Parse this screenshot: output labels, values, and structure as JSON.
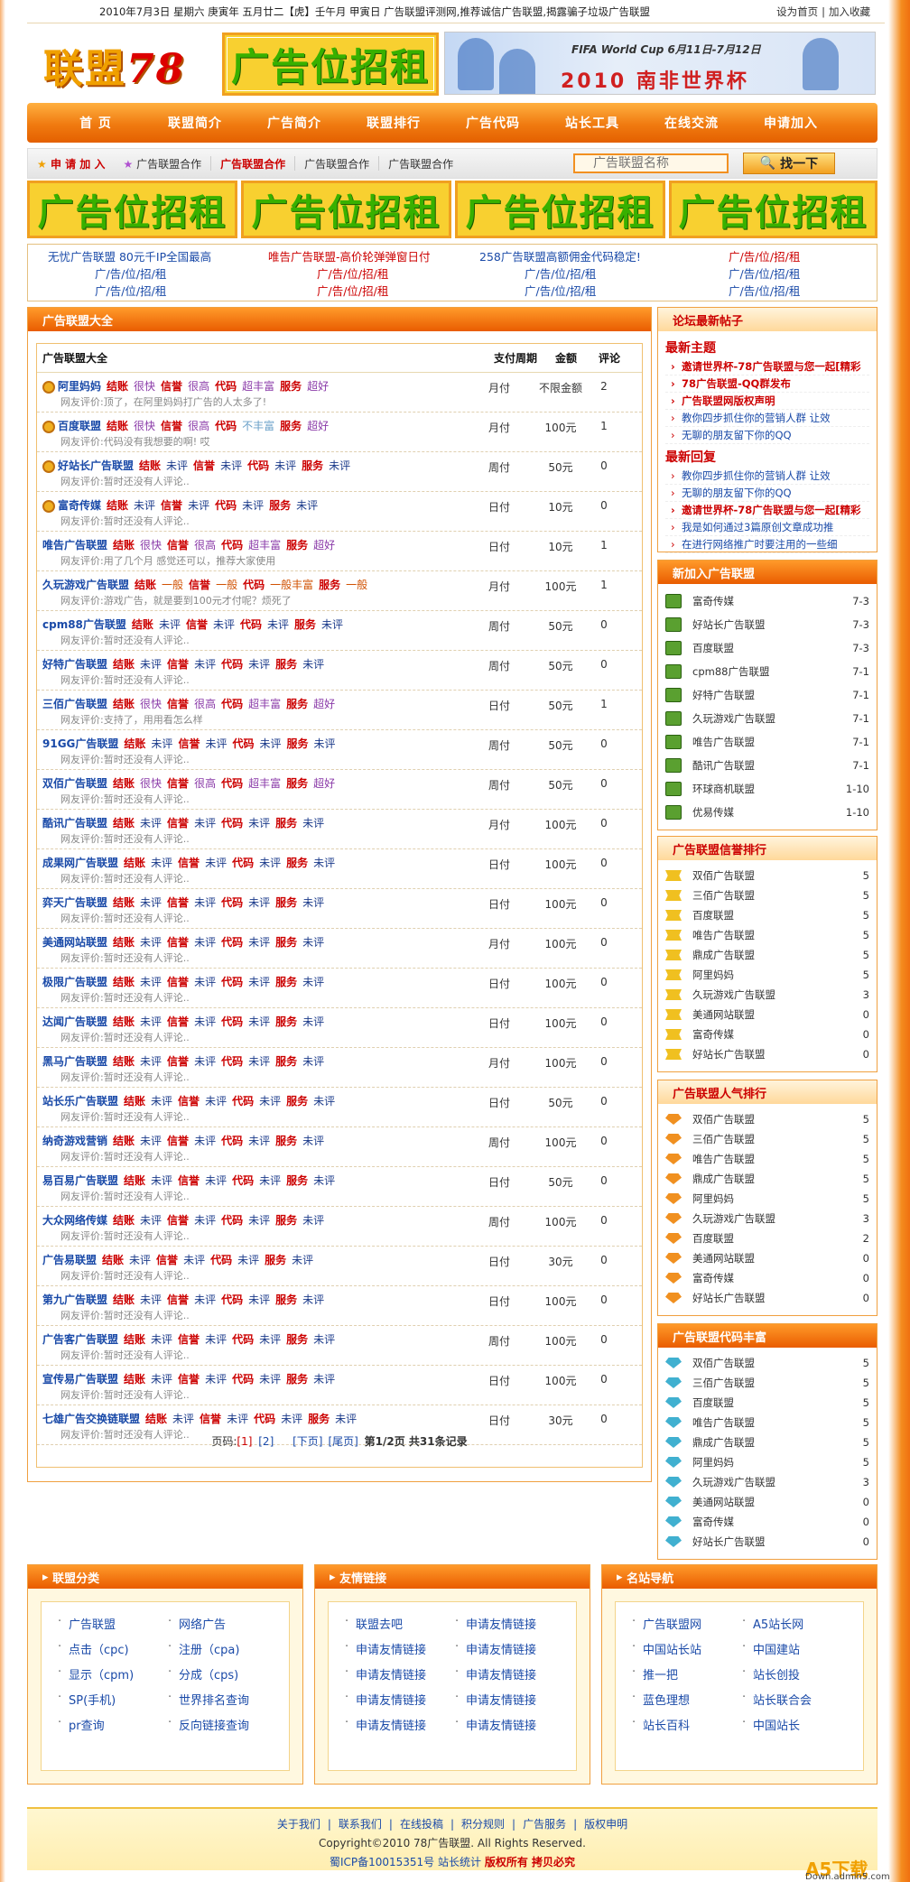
{
  "topbar": {
    "left": "2010年7月3日 星期六  庚寅年 五月廿二【虎】壬午月 甲寅日    广告联盟评测网,推荐诚信广告联盟,揭露骗子垃圾广告联盟",
    "set_home": "设为首页",
    "add_fav": "加入收藏"
  },
  "logo": {
    "cn": "联盟",
    "num": "78"
  },
  "header_ad": "广告位招租",
  "banner": {
    "line1": "FIFA World Cup 6月11日-7月12日",
    "line2": "2010 南非世界杯"
  },
  "nav": [
    "首 页",
    "联盟简介",
    "广告简介",
    "联盟排行",
    "广告代码",
    "站长工具",
    "在线交流",
    "申请加入"
  ],
  "subnav": {
    "join": "申 请 加 入",
    "items": [
      "广告联盟合作",
      "广告联盟合作",
      "广告联盟合作",
      "广告联盟合作"
    ],
    "search_placeholder": "广告联盟名称",
    "search_btn": "找一下"
  },
  "ad_row": [
    "广告位招租",
    "广告位招租",
    "广告位招租",
    "广告位招租"
  ],
  "links": {
    "row1": [
      "无忧广告联盟 80元千IP全国最高",
      "唯告广告联盟-高价轮弹弹窗日付",
      "258广告联盟高额佣金代码稳定!",
      "广/告/位/招/租"
    ],
    "rest": "广/告/位/招/租"
  },
  "main": {
    "title": "广告联盟大全",
    "cols": {
      "name": "广告联盟大全",
      "period": "支付周期",
      "amount": "金额",
      "comments": "评论"
    },
    "labels": {
      "settle": "结账",
      "credit": "信誉",
      "code": "代码",
      "service": "服务",
      "comment": "网友评价:"
    },
    "rows": [
      {
        "name": "阿里妈妈",
        "medal": true,
        "settle": "很快",
        "credit": "很高",
        "code": "超丰富",
        "service": "超好",
        "c": "顶了，在阿里妈妈打广告的人太多了!",
        "per": "月付",
        "amt": "不限金额",
        "cnt": "2"
      },
      {
        "name": "百度联盟",
        "medal": true,
        "settle": "很快",
        "credit": "很高",
        "code": "不丰富",
        "service": "超好",
        "c": "代码没有我想要的啊! 哎",
        "per": "月付",
        "amt": "100元",
        "cnt": "1"
      },
      {
        "name": "好站长广告联盟",
        "medal": true,
        "settle": "未评",
        "credit": "未评",
        "code": "未评",
        "service": "未评",
        "c": "暂时还没有人评论..",
        "per": "周付",
        "amt": "50元",
        "cnt": "0"
      },
      {
        "name": "富奇传媒",
        "medal": true,
        "settle": "未评",
        "credit": "未评",
        "code": "未评",
        "service": "未评",
        "c": "暂时还没有人评论..",
        "per": "日付",
        "amt": "10元",
        "cnt": "0"
      },
      {
        "name": "唯告广告联盟",
        "medal": false,
        "settle": "很快",
        "credit": "很高",
        "code": "超丰富",
        "service": "超好",
        "c": "用了几个月 感觉还可以，推荐大家使用",
        "per": "日付",
        "amt": "10元",
        "cnt": "1"
      },
      {
        "name": "久玩游戏广告联盟",
        "medal": false,
        "settle": "一般",
        "credit": "一般",
        "code": "一般丰富",
        "service": "一般",
        "c": "游戏广告，就是要到100元才付呢？烦死了",
        "per": "月付",
        "amt": "100元",
        "cnt": "1"
      },
      {
        "name": "cpm88广告联盟",
        "medal": false,
        "settle": "未评",
        "credit": "未评",
        "code": "未评",
        "service": "未评",
        "c": "暂时还没有人评论..",
        "per": "周付",
        "amt": "50元",
        "cnt": "0"
      },
      {
        "name": "好特广告联盟",
        "medal": false,
        "settle": "未评",
        "credit": "未评",
        "code": "未评",
        "service": "未评",
        "c": "暂时还没有人评论..",
        "per": "周付",
        "amt": "50元",
        "cnt": "0"
      },
      {
        "name": "三佰广告联盟",
        "medal": false,
        "settle": "很快",
        "credit": "很高",
        "code": "超丰富",
        "service": "超好",
        "c": "支持了，用用看怎么样",
        "per": "日付",
        "amt": "50元",
        "cnt": "1"
      },
      {
        "name": "91GG广告联盟",
        "medal": false,
        "settle": "未评",
        "credit": "未评",
        "code": "未评",
        "service": "未评",
        "c": "暂时还没有人评论..",
        "per": "周付",
        "amt": "50元",
        "cnt": "0"
      },
      {
        "name": "双佰广告联盟",
        "medal": false,
        "settle": "很快",
        "credit": "很高",
        "code": "超丰富",
        "service": "超好",
        "c": "暂时还没有人评论..",
        "per": "周付",
        "amt": "50元",
        "cnt": "0"
      },
      {
        "name": "酷讯广告联盟",
        "medal": false,
        "settle": "未评",
        "credit": "未评",
        "code": "未评",
        "service": "未评",
        "c": "暂时还没有人评论..",
        "per": "月付",
        "amt": "100元",
        "cnt": "0"
      },
      {
        "name": "成果网广告联盟",
        "medal": false,
        "settle": "未评",
        "credit": "未评",
        "code": "未评",
        "service": "未评",
        "c": "暂时还没有人评论..",
        "per": "日付",
        "amt": "100元",
        "cnt": "0"
      },
      {
        "name": "弈天广告联盟",
        "medal": false,
        "settle": "未评",
        "credit": "未评",
        "code": "未评",
        "service": "未评",
        "c": "暂时还没有人评论..",
        "per": "日付",
        "amt": "100元",
        "cnt": "0"
      },
      {
        "name": "美通网站联盟",
        "medal": false,
        "settle": "未评",
        "credit": "未评",
        "code": "未评",
        "service": "未评",
        "c": "暂时还没有人评论..",
        "per": "月付",
        "amt": "100元",
        "cnt": "0"
      },
      {
        "name": "极限广告联盟",
        "medal": false,
        "settle": "未评",
        "credit": "未评",
        "code": "未评",
        "service": "未评",
        "c": "暂时还没有人评论..",
        "per": "日付",
        "amt": "100元",
        "cnt": "0"
      },
      {
        "name": "达闻广告联盟",
        "medal": false,
        "settle": "未评",
        "credit": "未评",
        "code": "未评",
        "service": "未评",
        "c": "暂时还没有人评论..",
        "per": "日付",
        "amt": "100元",
        "cnt": "0"
      },
      {
        "name": "黑马广告联盟",
        "medal": false,
        "settle": "未评",
        "credit": "未评",
        "code": "未评",
        "service": "未评",
        "c": "暂时还没有人评论..",
        "per": "月付",
        "amt": "100元",
        "cnt": "0"
      },
      {
        "name": "站长乐广告联盟",
        "medal": false,
        "settle": "未评",
        "credit": "未评",
        "code": "未评",
        "service": "未评",
        "c": "暂时还没有人评论..",
        "per": "日付",
        "amt": "50元",
        "cnt": "0"
      },
      {
        "name": "纳奇游戏营销",
        "medal": false,
        "settle": "未评",
        "credit": "未评",
        "code": "未评",
        "service": "未评",
        "c": "暂时还没有人评论..",
        "per": "周付",
        "amt": "100元",
        "cnt": "0"
      },
      {
        "name": "易百易广告联盟",
        "medal": false,
        "settle": "未评",
        "credit": "未评",
        "code": "未评",
        "service": "未评",
        "c": "暂时还没有人评论..",
        "per": "日付",
        "amt": "50元",
        "cnt": "0"
      },
      {
        "name": "大众网络传媒",
        "medal": false,
        "settle": "未评",
        "credit": "未评",
        "code": "未评",
        "service": "未评",
        "c": "暂时还没有人评论..",
        "per": "周付",
        "amt": "100元",
        "cnt": "0"
      },
      {
        "name": "广告易联盟",
        "medal": false,
        "settle": "未评",
        "credit": "未评",
        "code": "未评",
        "service": "未评",
        "c": "暂时还没有人评论..",
        "per": "日付",
        "amt": "30元",
        "cnt": "0"
      },
      {
        "name": "第九广告联盟",
        "medal": false,
        "settle": "未评",
        "credit": "未评",
        "code": "未评",
        "service": "未评",
        "c": "暂时还没有人评论..",
        "per": "日付",
        "amt": "100元",
        "cnt": "0"
      },
      {
        "name": "广告客广告联盟",
        "medal": false,
        "settle": "未评",
        "credit": "未评",
        "code": "未评",
        "service": "未评",
        "c": "暂时还没有人评论..",
        "per": "周付",
        "amt": "100元",
        "cnt": "0"
      },
      {
        "name": "宣传易广告联盟",
        "medal": false,
        "settle": "未评",
        "credit": "未评",
        "code": "未评",
        "service": "未评",
        "c": "暂时还没有人评论..",
        "per": "日付",
        "amt": "100元",
        "cnt": "0"
      },
      {
        "name": "七雄广告交换链联盟",
        "medal": false,
        "settle": "未评",
        "credit": "未评",
        "code": "未评",
        "service": "未评",
        "c": "暂时还没有人评论..",
        "per": "日付",
        "amt": "30元",
        "cnt": "0"
      }
    ],
    "pager": {
      "label": "页码:",
      "p1": "[1]",
      "p2": "[2]",
      "next": "[下页]",
      "last": "[尾页]",
      "info": "第1/2页 共31条记录"
    }
  },
  "forum": {
    "title": "论坛最新帖子",
    "new_topics": "最新主题",
    "topics": [
      {
        "t": "邀请世界杯-78广告联盟与您一起[精彩",
        "c": "red"
      },
      {
        "t": "78广告联盟-QQ群发布",
        "c": "red"
      },
      {
        "t": "广告联盟网版权声明",
        "c": "red"
      },
      {
        "t": "教你四步抓住你的营销人群 让效",
        "c": "blue"
      },
      {
        "t": "无聊的朋友留下你的QQ",
        "c": "blue"
      }
    ],
    "new_replies": "最新回复",
    "replies": [
      {
        "t": "教你四步抓住你的营销人群 让效",
        "c": "blue"
      },
      {
        "t": "无聊的朋友留下你的QQ",
        "c": "blue"
      },
      {
        "t": "邀请世界杯-78广告联盟与您一起[精彩",
        "c": "red"
      },
      {
        "t": "我是如何通过3篇原创文章成功推",
        "c": "blue"
      },
      {
        "t": "在进行网络推广时要注用的一些细",
        "c": "blue"
      }
    ]
  },
  "newjoin": {
    "title": "新加入广告联盟",
    "items": [
      {
        "n": "富奇传媒",
        "v": "7-3"
      },
      {
        "n": "好站长广告联盟",
        "v": "7-3"
      },
      {
        "n": "百度联盟",
        "v": "7-3"
      },
      {
        "n": "cpm88广告联盟",
        "v": "7-1"
      },
      {
        "n": "好特广告联盟",
        "v": "7-1"
      },
      {
        "n": "久玩游戏广告联盟",
        "v": "7-1"
      },
      {
        "n": "唯告广告联盟",
        "v": "7-1"
      },
      {
        "n": "酷讯广告联盟",
        "v": "7-1"
      },
      {
        "n": "环球商机联盟",
        "v": "1-10"
      },
      {
        "n": "优易传媒",
        "v": "1-10"
      }
    ]
  },
  "credit": {
    "title": "广告联盟信誉排行",
    "items": [
      {
        "n": "双佰广告联盟",
        "v": "5"
      },
      {
        "n": "三佰广告联盟",
        "v": "5"
      },
      {
        "n": "百度联盟",
        "v": "5"
      },
      {
        "n": "唯告广告联盟",
        "v": "5"
      },
      {
        "n": "鼎成广告联盟",
        "v": "5"
      },
      {
        "n": "阿里妈妈",
        "v": "5"
      },
      {
        "n": "久玩游戏广告联盟",
        "v": "3"
      },
      {
        "n": "美通网站联盟",
        "v": "0"
      },
      {
        "n": "富奇传媒",
        "v": "0"
      },
      {
        "n": "好站长广告联盟",
        "v": "0"
      }
    ]
  },
  "popular": {
    "title": "广告联盟人气排行",
    "items": [
      {
        "n": "双佰广告联盟",
        "v": "5"
      },
      {
        "n": "三佰广告联盟",
        "v": "5"
      },
      {
        "n": "唯告广告联盟",
        "v": "5"
      },
      {
        "n": "鼎成广告联盟",
        "v": "5"
      },
      {
        "n": "阿里妈妈",
        "v": "5"
      },
      {
        "n": "久玩游戏广告联盟",
        "v": "3"
      },
      {
        "n": "百度联盟",
        "v": "2"
      },
      {
        "n": "美通网站联盟",
        "v": "0"
      },
      {
        "n": "富奇传媒",
        "v": "0"
      },
      {
        "n": "好站长广告联盟",
        "v": "0"
      }
    ]
  },
  "richcode": {
    "title": "广告联盟代码丰富",
    "items": [
      {
        "n": "双佰广告联盟",
        "v": "5"
      },
      {
        "n": "三佰广告联盟",
        "v": "5"
      },
      {
        "n": "百度联盟",
        "v": "5"
      },
      {
        "n": "唯告广告联盟",
        "v": "5"
      },
      {
        "n": "鼎成广告联盟",
        "v": "5"
      },
      {
        "n": "阿里妈妈",
        "v": "5"
      },
      {
        "n": "久玩游戏广告联盟",
        "v": "3"
      },
      {
        "n": "美通网站联盟",
        "v": "0"
      },
      {
        "n": "富奇传媒",
        "v": "0"
      },
      {
        "n": "好站长广告联盟",
        "v": "0"
      }
    ]
  },
  "categories": {
    "title": "联盟分类",
    "items": [
      "广告联盟",
      "网络广告",
      "点击（cpc)",
      "注册（cpa)",
      "显示（cpm)",
      "分成（cps)",
      "SP(手机)",
      "世界排名查询",
      "pr查询",
      "反向链接查询"
    ]
  },
  "friends": {
    "title": "友情链接",
    "items": [
      "联盟去吧",
      "申请友情链接",
      "申请友情链接",
      "申请友情链接",
      "申请友情链接",
      "申请友情链接",
      "申请友情链接",
      "申请友情链接",
      "申请友情链接",
      "申请友情链接"
    ]
  },
  "sites": {
    "title": "名站导航",
    "items": [
      "广告联盟网",
      "A5站长网",
      "中国站长站",
      "中国建站",
      "推一把",
      "站长创投",
      "蓝色理想",
      "站长联合会",
      "站长百科",
      "中国站长"
    ]
  },
  "footer": {
    "links": [
      "关于我们",
      "联系我们",
      "在线投稿",
      "积分规则",
      "广告服务",
      "版权申明"
    ],
    "copyright": "Copyright©2010 78广告联盟. All Rights Reserved.",
    "icp": "蜀ICP备10015351号 站长统计",
    "rights": "版权所有 拷贝必究"
  },
  "watermark": {
    "big": "A5下载",
    "small": "Down.admin5.com"
  }
}
